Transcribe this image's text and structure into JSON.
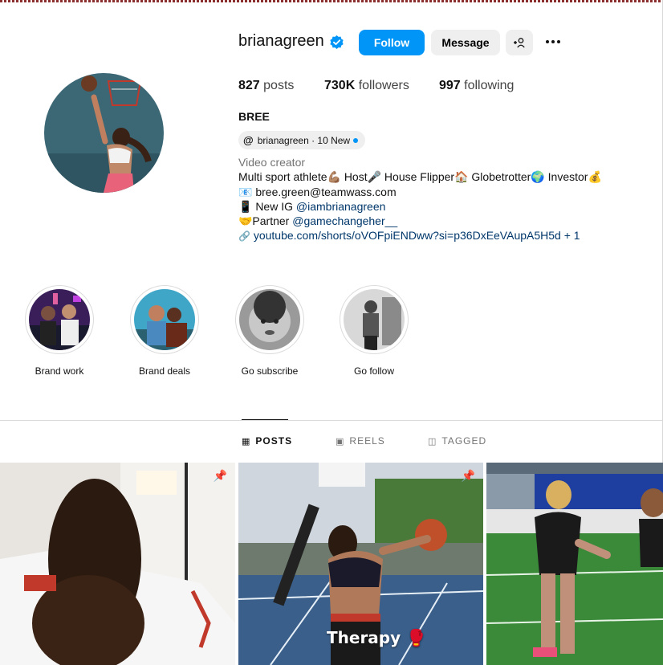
{
  "profile": {
    "username": "brianagreen",
    "verified": true,
    "follow_label": "Follow",
    "message_label": "Message",
    "add_user_icon": "+person-icon",
    "more_icon": "ellipsis-icon",
    "stats": {
      "posts_count": "827",
      "posts_label": "posts",
      "followers_count": "730K",
      "followers_label": "followers",
      "following_count": "997",
      "following_label": "following"
    },
    "full_name": "BREE",
    "threads_chip": {
      "handle": "brianagreen · 10 New"
    },
    "bio": {
      "category": "Video creator",
      "line1": "Multi sport athlete💪🏽 Host🎤 House Flipper🏠 Globetrotter🌍 Investor💰",
      "email_prefix": "📧",
      "email": "bree.green@teamwass.com",
      "new_ig_prefix": "📱 New IG",
      "new_ig": "@iambrianagreen",
      "partner_prefix": "🤝Partner",
      "partner": "@gamechangeher__",
      "link": "youtube.com/shorts/oVOFpiENDww?si=p36DxEeVAupA5H5d + 1"
    }
  },
  "highlights": [
    {
      "label": "Brand work"
    },
    {
      "label": "Brand deals"
    },
    {
      "label": "Go subscribe"
    },
    {
      "label": "Go follow"
    }
  ],
  "tabs": [
    {
      "label": "POSTS",
      "icon": "grid-icon",
      "active": true
    },
    {
      "label": "REELS",
      "icon": "reels-icon",
      "active": false
    },
    {
      "label": "TAGGED",
      "icon": "tagged-icon",
      "active": false
    }
  ],
  "posts": [
    {
      "pinned": true,
      "overlay": ""
    },
    {
      "pinned": true,
      "overlay": "Therapy 🥊"
    },
    {
      "pinned": false,
      "overlay": ""
    }
  ],
  "colors": {
    "accent": "#0095f6",
    "button_bg": "#efefef",
    "link": "#00376b"
  }
}
